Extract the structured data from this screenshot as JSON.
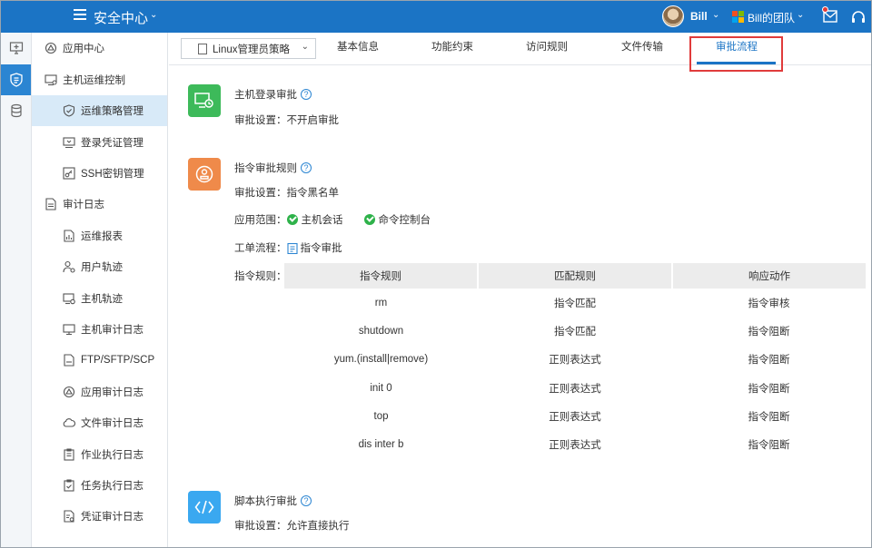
{
  "topbar": {
    "title": "安全中心",
    "user_name": "Bill",
    "team_name": "Bill的团队"
  },
  "rail": [
    "app-grid-icon",
    "shield-audit-icon",
    "database-icon"
  ],
  "sidebar": {
    "items": [
      {
        "label": "应用中心",
        "level": 1,
        "icon": "app-center-icon"
      },
      {
        "label": "主机运维控制",
        "level": 1,
        "icon": "host-ops-icon"
      },
      {
        "label": "运维策略管理",
        "level": 2,
        "icon": "shield-check-icon",
        "active": true
      },
      {
        "label": "登录凭证管理",
        "level": 2,
        "icon": "credential-icon"
      },
      {
        "label": "SSH密钥管理",
        "level": 2,
        "icon": "key-icon"
      },
      {
        "label": "审计日志",
        "level": 1,
        "icon": "audit-log-icon"
      },
      {
        "label": "运维报表",
        "level": 2,
        "icon": "report-icon"
      },
      {
        "label": "用户轨迹",
        "level": 2,
        "icon": "user-track-icon"
      },
      {
        "label": "主机轨迹",
        "level": 2,
        "icon": "host-track-icon"
      },
      {
        "label": "主机审计日志",
        "level": 2,
        "icon": "monitor-icon"
      },
      {
        "label": "FTP/SFTP/SCP",
        "level": 2,
        "icon": "ftp-icon"
      },
      {
        "label": "应用审计日志",
        "level": 2,
        "icon": "app-audit-icon"
      },
      {
        "label": "文件审计日志",
        "level": 2,
        "icon": "cloud-file-icon"
      },
      {
        "label": "作业执行日志",
        "level": 2,
        "icon": "job-log-icon"
      },
      {
        "label": "任务执行日志",
        "level": 2,
        "icon": "task-log-icon"
      },
      {
        "label": "凭证审计日志",
        "level": 2,
        "icon": "cert-audit-icon"
      }
    ]
  },
  "tabs": {
    "policy_select": "Linux管理员策略",
    "items": [
      {
        "label": "基本信息"
      },
      {
        "label": "功能约束"
      },
      {
        "label": "访问规则"
      },
      {
        "label": "文件传输"
      },
      {
        "label": "审批流程",
        "active": true
      }
    ]
  },
  "sections": {
    "login": {
      "title": "主机登录审批",
      "setting_label": "审批设置：",
      "setting_value": "不开启审批"
    },
    "command": {
      "title": "指令审批规则",
      "setting_label": "审批设置：",
      "setting_value": "指令黑名单",
      "scope_label": "应用范围：",
      "scope_items": [
        "主机会话",
        "命令控制台"
      ],
      "workflow_label": "工单流程：",
      "workflow_value": "指令审批",
      "rules_label": "指令规则：",
      "table": {
        "headers": [
          "指令规则",
          "匹配规则",
          "响应动作"
        ],
        "rows": [
          [
            "rm",
            "指令匹配",
            "指令审核"
          ],
          [
            "shutdown",
            "指令匹配",
            "指令阻断"
          ],
          [
            "yum.(install|remove)",
            "正则表达式",
            "指令阻断"
          ],
          [
            "init 0",
            "正则表达式",
            "指令阻断"
          ],
          [
            "top",
            "正则表达式",
            "指令阻断"
          ],
          [
            "dis inter b",
            "正则表达式",
            "指令阻断"
          ]
        ]
      }
    },
    "script": {
      "title": "脚本执行审批",
      "setting_label": "审批设置：",
      "setting_value": "允许直接执行"
    }
  },
  "colors": {
    "brand": "#1b74c5",
    "login_icon": "#3dba5a",
    "command_icon": "#ef8a4a",
    "script_icon": "#3aa8f0",
    "highlight": "#e03b3b"
  }
}
